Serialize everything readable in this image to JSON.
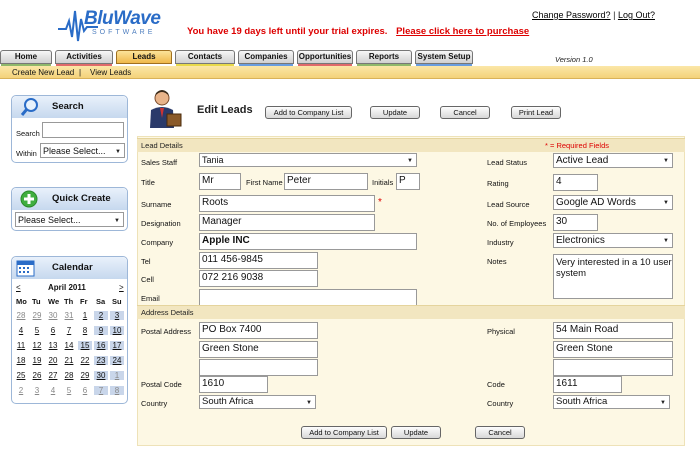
{
  "header": {
    "logo_main": "BluWave",
    "logo_sub": "SOFTWARE",
    "trial_text": "You have 19 days left until your trial expires.",
    "trial_link": "Please click here to purchase",
    "change_password": "Change Password?",
    "separator": "|",
    "logout": "Log Out?",
    "version": "Version 1.0"
  },
  "tabs": [
    {
      "label": "Home",
      "color": "#8fb86a"
    },
    {
      "label": "Activities",
      "color": "#e06a6a"
    },
    {
      "label": "Leads",
      "color": "#f0b84a"
    },
    {
      "label": "Contacts",
      "color": "#e8d94a"
    },
    {
      "label": "Companies",
      "color": "#6a9ee0"
    },
    {
      "label": "Opportunities",
      "color": "#e06a6a"
    },
    {
      "label": "Reports",
      "color": "#8fb86a"
    },
    {
      "label": "System Setup",
      "color": "#6a9ee0"
    }
  ],
  "subnav": {
    "create": "Create New Lead",
    "sep": "|",
    "view": "View Leads"
  },
  "search": {
    "title": "Search",
    "search_label": "Search",
    "within_label": "Within",
    "within_value": "Please Select..."
  },
  "quick_create": {
    "title": "Quick Create",
    "value": "Please Select..."
  },
  "calendar": {
    "title": "Calendar",
    "month": "April 2011",
    "prev": "<",
    "next": ">",
    "days": [
      "Mo",
      "Tu",
      "We",
      "Th",
      "Fr",
      "Sa",
      "Su"
    ],
    "weeks": [
      [
        "28",
        "29",
        "30",
        "31",
        "1",
        "2",
        "3"
      ],
      [
        "4",
        "5",
        "6",
        "7",
        "8",
        "9",
        "10"
      ],
      [
        "11",
        "12",
        "13",
        "14",
        "15",
        "16",
        "17"
      ],
      [
        "18",
        "19",
        "20",
        "21",
        "22",
        "23",
        "24"
      ],
      [
        "25",
        "26",
        "27",
        "28",
        "29",
        "30",
        "1"
      ],
      [
        "2",
        "3",
        "4",
        "5",
        "6",
        "7",
        "8"
      ]
    ]
  },
  "page": {
    "title": "Edit Leads",
    "btn_add_company": "Add to Company List",
    "btn_update": "Update",
    "btn_cancel": "Cancel",
    "btn_print": "Print Lead",
    "required_note": "* = Required Fields",
    "section_lead": "Lead Details",
    "section_address": "Address Details"
  },
  "lead": {
    "sales_staff_label": "Sales Staff",
    "sales_staff": "Tania",
    "title_label": "Title",
    "title": "Mr",
    "first_name_label": "First Name",
    "first_name": "Peter",
    "initials_label": "Initials",
    "initials": "P",
    "surname_label": "Surname",
    "surname": "Roots",
    "required_mark": "*",
    "designation_label": "Designation",
    "designation": "Manager",
    "company_label": "Company",
    "company": "Apple INC",
    "tel_label": "Tel",
    "tel": "011 456-9845",
    "cell_label": "Cell",
    "cell": "072 216 9038",
    "email_label": "Email",
    "email": "",
    "status_label": "Lead Status",
    "status": "Active Lead",
    "rating_label": "Rating",
    "rating": "4",
    "source_label": "Lead Source",
    "source": "Google AD Words",
    "employees_label": "No. of Employees",
    "employees": "30",
    "industry_label": "Industry",
    "industry": "Electronics",
    "notes_label": "Notes",
    "notes": "Very interested in a 10 user system"
  },
  "address": {
    "postal_label": "Postal Address",
    "postal_1": "PO Box 7400",
    "postal_2": "Green Stone",
    "postal_3": "",
    "postal_code_label": "Postal Code",
    "postal_code": "1610",
    "country_label": "Country",
    "country": "South Africa",
    "physical_label": "Physical",
    "physical_1": "54 Main Road",
    "physical_2": "Green Stone",
    "physical_3": "",
    "code_label": "Code",
    "code": "1611",
    "country2_label": "Country",
    "country2": "South Africa"
  }
}
